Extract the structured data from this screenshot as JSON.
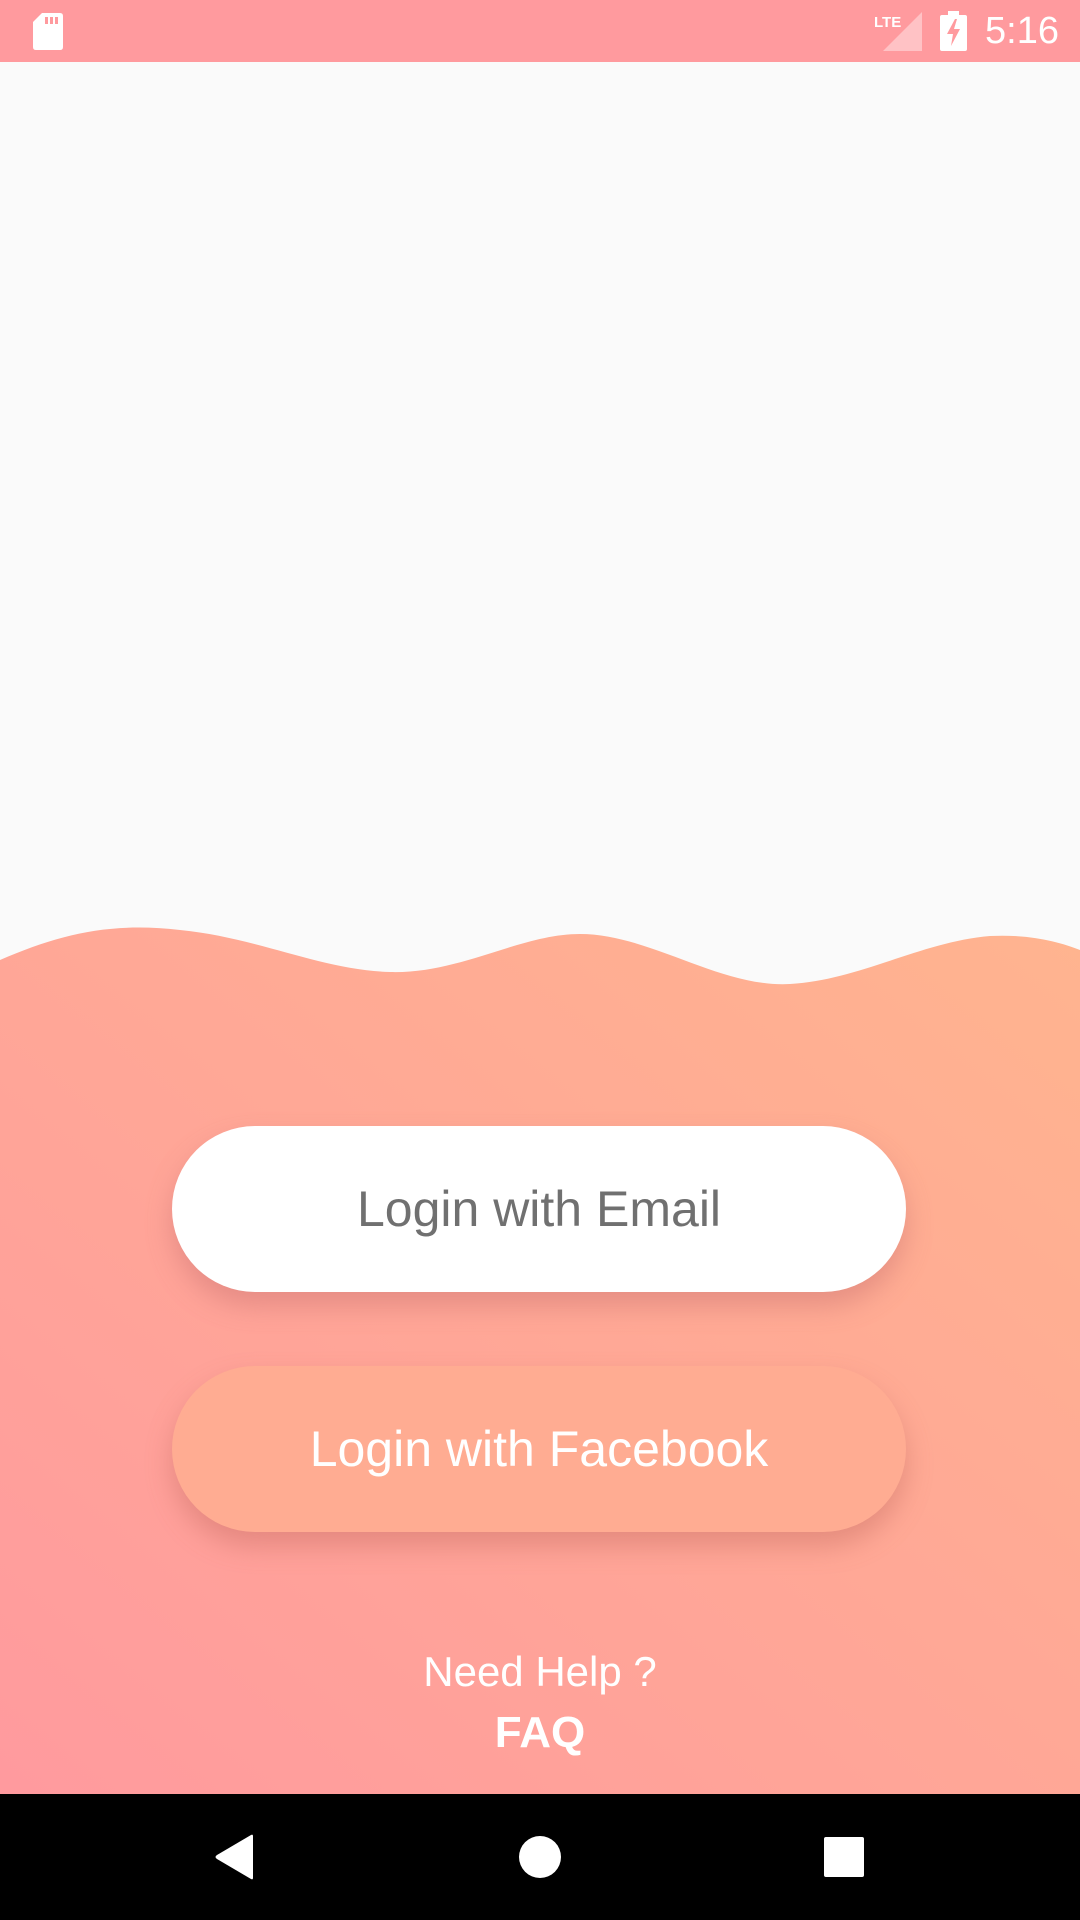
{
  "status_bar": {
    "time": "5:16",
    "network_label": "LTE",
    "icons": [
      "sd-card-icon",
      "lte-signal-icon",
      "battery-charging-icon"
    ],
    "background_color": "#ff9a9e"
  },
  "login": {
    "email_button_label": "Login with Email",
    "facebook_button_label": "Login with Facebook",
    "help_text": "Need Help ?",
    "faq_label": "FAQ"
  },
  "theme": {
    "gradient_start": "#ff9a9e",
    "gradient_end": "#ffb48f",
    "page_background": "#fafafa"
  },
  "nav_bar": {
    "icons": [
      "back-icon",
      "home-icon",
      "recents-icon"
    ]
  }
}
